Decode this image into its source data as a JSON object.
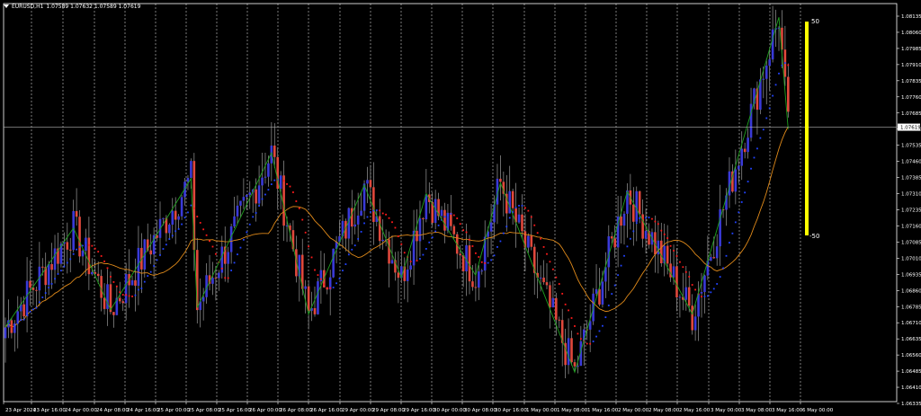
{
  "header": {
    "title": "EURUSD,H1",
    "ohlc": "1.07589 1.07632 1.07589 1.07619"
  },
  "colors": {
    "background": "#000000",
    "axis": "#ffffff",
    "grid": "#ffffff",
    "bull_candle": "#3a3ad8",
    "bear_candle": "#e0483c",
    "zigzag": "#1fa21f",
    "ma_line": "#e08a1a",
    "trail_up": "#2244ff",
    "trail_down": "#ff1a1a",
    "oscillator_bar": "#ffff00",
    "price_line": "#b0b0b0"
  },
  "chart_data": {
    "type": "candlestick",
    "symbol": "EURUSD",
    "timeframe": "H1",
    "ylim": [
      1.06335,
      1.08135
    ],
    "y_ticks": [
      "1.08135",
      "1.08060",
      "1.07985",
      "1.07910",
      "1.07835",
      "1.07760",
      "1.07685",
      "1.07610",
      "1.07535",
      "1.07460",
      "1.07385",
      "1.07310",
      "1.07235",
      "1.07160",
      "1.07085",
      "1.07010",
      "1.06935",
      "1.06860",
      "1.06785",
      "1.06710",
      "1.06635",
      "1.06560",
      "1.06485",
      "1.06410",
      "1.06335"
    ],
    "x_ticks": [
      "23 Apr 2024",
      "23 Apr 16:00",
      "24 Apr 00:00",
      "24 Apr 08:00",
      "24 Apr 16:00",
      "25 Apr 00:00",
      "25 Apr 08:00",
      "25 Apr 16:00",
      "26 Apr 00:00",
      "26 Apr 08:00",
      "26 Apr 16:00",
      "29 Apr 00:00",
      "29 Apr 08:00",
      "29 Apr 16:00",
      "30 Apr 00:00",
      "30 Apr 08:00",
      "30 Apr 16:00",
      "1 May 00:00",
      "1 May 08:00",
      "1 May 16:00",
      "2 May 00:00",
      "2 May 08:00",
      "2 May 16:00",
      "3 May 00:00",
      "3 May 08:00",
      "3 May 16:00",
      "6 May 00:00"
    ],
    "current_price": "1.07619",
    "zigzag": [
      [
        0,
        1.0669
      ],
      [
        22,
        1.0715
      ],
      [
        34,
        1.0677
      ],
      [
        60,
        1.0738
      ],
      [
        62,
        1.0678
      ],
      [
        86,
        1.075
      ],
      [
        98,
        1.0675
      ],
      [
        116,
        1.0735
      ],
      [
        128,
        1.0692
      ],
      [
        136,
        1.0731
      ],
      [
        152,
        1.0693
      ],
      [
        160,
        1.0736
      ],
      [
        184,
        1.0648
      ],
      [
        201,
        1.0732
      ],
      [
        222,
        1.0675
      ],
      [
        250,
        1.0813
      ],
      [
        253,
        1.0761
      ]
    ],
    "oscillator": {
      "levels": [
        "50",
        "-50"
      ],
      "range": [
        -50,
        50
      ],
      "value": 50
    }
  }
}
